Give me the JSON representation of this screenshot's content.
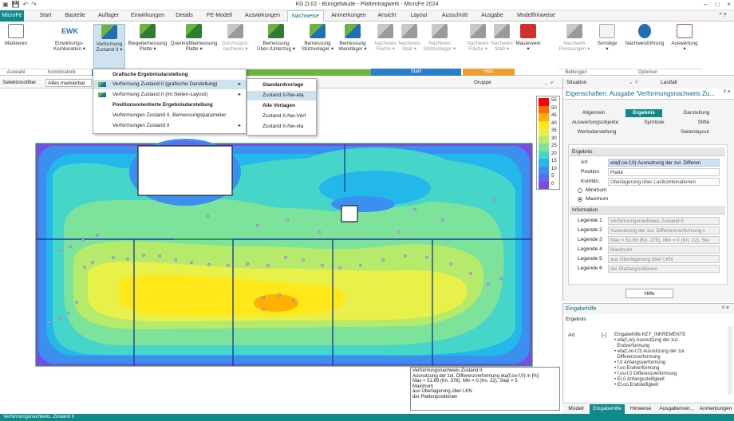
{
  "window": {
    "title": "KG.D.02 - Bürogebäude - Plattentragwerk - MicroFe 2024",
    "controls": [
      "–",
      "□",
      "×"
    ]
  },
  "tabs": [
    "MicroFe",
    "Start",
    "Bauteile",
    "Auflager",
    "Einwirkungen",
    "Details",
    "FE-Modell",
    "Auswirkungen",
    "Nachweise",
    "Anmerkungen",
    "Ansicht",
    "Layout",
    "Ausschnitt",
    "Ausgabe",
    "Modellhinweise"
  ],
  "ribbon": {
    "buttons": [
      {
        "label": "Markieren",
        "icon": "cursor-icon"
      },
      {
        "label": "Einwirkungs-\nKombination ▾",
        "icon": "ewk-icon",
        "text": "EWK"
      },
      {
        "label": "Verformung\nZustand II ▾",
        "icon": "verformung-icon"
      },
      {
        "label": "Biegebemessung\nPlatte ▾",
        "icon": "biegebemessung-icon"
      },
      {
        "label": "Querkraftbemessung\nPlatte ▾",
        "icon": "querkraft-icon"
      },
      {
        "label": "Durchstanz-\nnachweis ▾",
        "icon": "durchstanz-icon"
      },
      {
        "label": "Bemessung\nÜber-/Unterzug ▾",
        "icon": "unterzug-icon"
      },
      {
        "label": "Bemessung\nStützenlager ▾",
        "icon": "stuetzenlager-icon"
      },
      {
        "label": "Bemessung\nWandlager ▾",
        "icon": "wandlager-icon"
      },
      {
        "label": "Nachweis\nFläche ▾",
        "icon": "stahl-flaeche-icon"
      },
      {
        "label": "Nachweis\nStab ▾",
        "icon": "stahl-stab-icon"
      },
      {
        "label": "Nachweis\nStützenlager ▾",
        "icon": "stahl-lager-icon"
      },
      {
        "label": "Nachweis\nFläche ▾",
        "icon": "holz-flaeche-icon"
      },
      {
        "label": "Nachweis\nStab ▾",
        "icon": "holz-stab-icon"
      },
      {
        "label": "Mauerwerk\n▾",
        "icon": "mauerwerk-icon"
      },
      {
        "label": "Nachweis\nPressungen ▾",
        "icon": "pressungen-icon"
      },
      {
        "label": "Sonstige\n▾",
        "icon": "sonstige-icon"
      },
      {
        "label": "Nachweisführung",
        "icon": "nachweisfuehrung-icon"
      },
      {
        "label": "Auswertung\n▾",
        "icon": "auswertung-icon"
      }
    ],
    "groups": [
      "Auswahl",
      "Kombinatorik",
      "Stahl",
      "Holz",
      "Bettungen",
      "Optionen"
    ],
    "group_colors": {
      "green": "#6db33f",
      "blue": "#2a7fc9",
      "orange": "#f39c34"
    }
  },
  "filterbar": {
    "label": "Selektionsfilter",
    "value": "Alles markierbar",
    "gruppe_label": "Gruppe"
  },
  "menu": {
    "items": [
      "Grafische Ergebnisdarstellung",
      "Verformung Zustand II (grafische Darstellung)",
      "Verformung Zustand II (im Seiten-Layout)",
      "Positionsorientierte Ergebnisdarstellung",
      "Verformungen Zustand II, Bemessungsparameter",
      "Verformungen Zustand II"
    ],
    "submenu": [
      "Standardvorlage",
      "Zustand II-Nw-eta",
      "Alle Vorlagen",
      "Zustand II-Nw-Verf",
      "Zustand II-Nw-vta"
    ]
  },
  "legend": {
    "values": [
      "55",
      "50",
      "45",
      "40",
      "35",
      "30",
      "25",
      "20",
      "15",
      "10",
      "5",
      "0"
    ],
    "colors": [
      "#ff0000",
      "#ff6b00",
      "#ffb000",
      "#ffe81a",
      "#e8f04a",
      "#b6ea6a",
      "#7de39b",
      "#46d6c9",
      "#22b8ea",
      "#3a8fef",
      "#5c6cf0",
      "#7a4af0"
    ]
  },
  "infobox": {
    "text": "Verformungsnachweis Zustand II\nAusnutzung der zul. Differenzverformung eta(f,oo-f,0) in [%]\nMax = 51.69 (Kn. 378), Min = 0 (Kn. 22), Step = 5\nMaximum\naus Überlagerung über LKN\nder Plattenpositionen"
  },
  "properties": {
    "situation_label": "Situation",
    "lastfall_label": "Lastfall",
    "title": "Eigenschaften: Ausgabe 'Verformungsnachweis Zu... ",
    "tabs": [
      "Allgemein",
      "Ergebnis",
      "Darstellung",
      "Auswertungsobjekte",
      "Symbole",
      "Stifte",
      "Wertedarstellung",
      "Seitenlayout"
    ],
    "ergebnis": {
      "section": "Ergebnis",
      "art_label": "Art",
      "art_value": "eta(f,oo-f,0) Ausnutzung der zul. Differen",
      "position_label": "Position",
      "position_value": "Platte",
      "kombin_label": "Kombin.",
      "kombin_value": "Überlagerung über Lastkombinationen",
      "minimum": "Minimum",
      "maximum": "Maximum"
    },
    "information": {
      "section": "Information",
      "rows": [
        {
          "label": "Legende 1",
          "value": "Verformungsnachweis Zustand II"
        },
        {
          "label": "Legende 2",
          "value": "Ausnutzung der zul. Differenzverformung ε"
        },
        {
          "label": "Legende 3",
          "value": "Max = 51.69 (Kn. 378), Min = 0 (Kn. 22), Ste"
        },
        {
          "label": "Legende 4",
          "value": "Maximum"
        },
        {
          "label": "Legende 5",
          "value": "aus Überlagerung über LKN"
        },
        {
          "label": "Legende 6",
          "value": "der Plattenpositionen"
        }
      ]
    },
    "hilfe": "Hilfe"
  },
  "help": {
    "title": "Eingabehilfe",
    "subtitle": "Ergebnis",
    "art": "Art",
    "marker": "[-]",
    "text": "Eingabehilfe KEY_INKREMENTE\n• eta(f,oo) Ausnutzung der zul.\n  Endverformung\n• eta(f,oo-f,0) Ausnutzung der zul.\n  Differenzverformung\n• f,0 Anfangsverformung\n• f,oo Endverformung\n• f,oo-f,0 Differenzverformung\n• EI,0 Anfangssteifigkeit\n• EI,oo Endsteifigkeit"
  },
  "bottom_tabs": [
    "Modell",
    "Eingabehilfe",
    "Hinweise",
    "Ausgabenver...",
    "Anmerkungen"
  ],
  "status": "Verformungsnachweis, Zustand II"
}
